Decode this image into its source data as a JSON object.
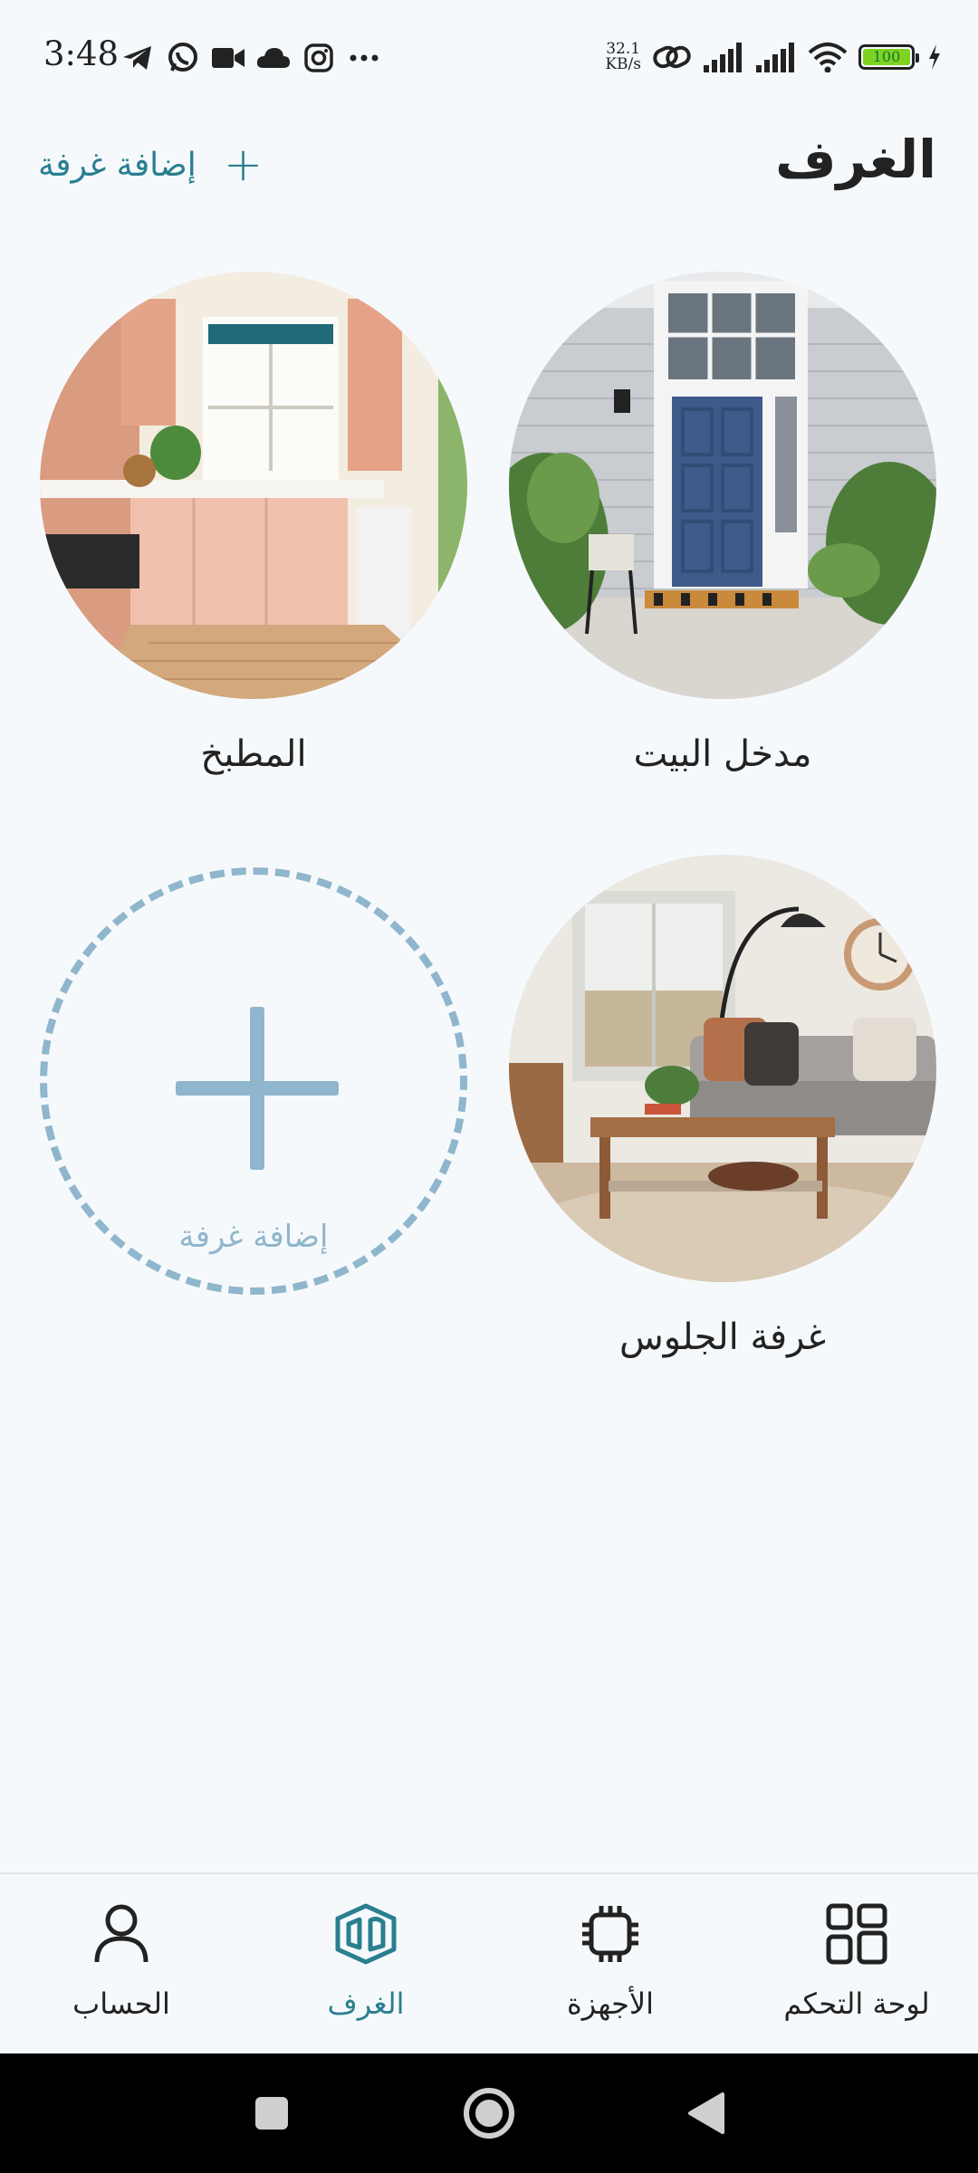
{
  "status_bar": {
    "time": "3:48",
    "network_speed_value": "32.1",
    "network_speed_unit": "KB/s",
    "battery_level": "100",
    "left_icons": [
      "telegram-icon",
      "whatsapp-icon",
      "video-icon",
      "cloud-icon",
      "instagram-icon",
      "more-icon"
    ],
    "right_icons": [
      "link-icon",
      "signal-icon",
      "signal-icon",
      "wifi-icon",
      "battery-icon",
      "charging-icon"
    ]
  },
  "header": {
    "title": "الغرف",
    "add_room_label": "إضافة غرفة",
    "add_room_icon": "plus-icon"
  },
  "rooms": [
    {
      "name": "مدخل البيت",
      "image": "front-door-photo"
    },
    {
      "name": "المطبخ",
      "image": "kitchen-photo"
    },
    {
      "name": "غرفة الجلوس",
      "image": "living-room-photo"
    }
  ],
  "add_room_tile": {
    "label": "إضافة غرفة",
    "icon": "plus-icon"
  },
  "bottom_nav": {
    "items": [
      {
        "label": "لوحة التحكم",
        "icon": "dashboard-icon",
        "active": false
      },
      {
        "label": "الأجهزة",
        "icon": "chip-icon",
        "active": false
      },
      {
        "label": "الغرف",
        "icon": "rooms-icon",
        "active": true
      },
      {
        "label": "الحساب",
        "icon": "person-icon",
        "active": false
      }
    ]
  },
  "system_nav": [
    "recents-button",
    "home-button",
    "back-button"
  ],
  "colors": {
    "background": "#f6f9fc",
    "accent": "#2a7f8f",
    "add_tile": "#8fb6cc",
    "text": "#222222"
  }
}
